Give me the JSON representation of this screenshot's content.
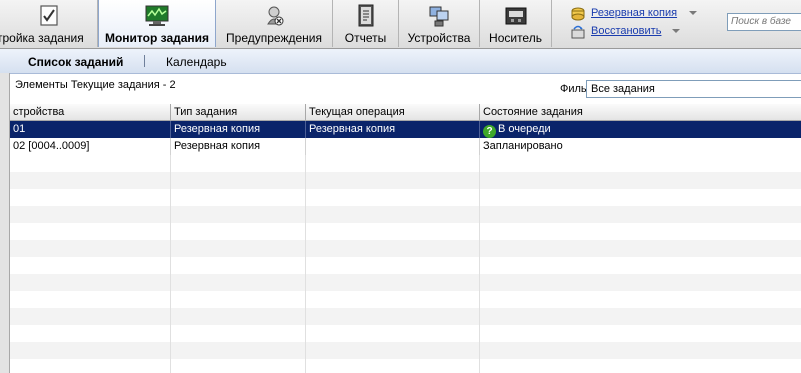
{
  "toolbar": {
    "buttons": [
      {
        "label": "тройка задания",
        "icon": "job-setup-icon"
      },
      {
        "label": "Монитор задания",
        "icon": "job-monitor-icon"
      },
      {
        "label": "Предупреждения",
        "icon": "alerts-icon"
      },
      {
        "label": "Отчеты",
        "icon": "reports-icon"
      },
      {
        "label": "Устройства",
        "icon": "devices-icon"
      },
      {
        "label": "Носитель",
        "icon": "media-icon"
      }
    ],
    "side_actions": {
      "backup": "Резервная копия",
      "restore": "Восстановить"
    },
    "search_placeholder": "Поиск в базе"
  },
  "subtabs": {
    "job_list": "Список заданий",
    "calendar": "Календарь"
  },
  "info": {
    "items_count": "Элементы Текущие задания - 2",
    "filter_label": "Фильтр:",
    "filter_value": "Все задания"
  },
  "grid": {
    "columns": [
      "стройства",
      "Тип задания",
      "Текущая операция",
      "Состояние задания"
    ],
    "rows": [
      {
        "device": "01",
        "job_type": "Резервная копия",
        "operation": "Резервная копия",
        "status": "В очереди",
        "selected": true
      },
      {
        "device": "02 [0004..0009]",
        "job_type": "Резервная копия",
        "operation": "",
        "status": "Запланировано",
        "selected": false
      }
    ]
  },
  "colors": {
    "selection": "#0a246a",
    "link": "#1a3cae",
    "queued_icon": "#3fa82a"
  }
}
